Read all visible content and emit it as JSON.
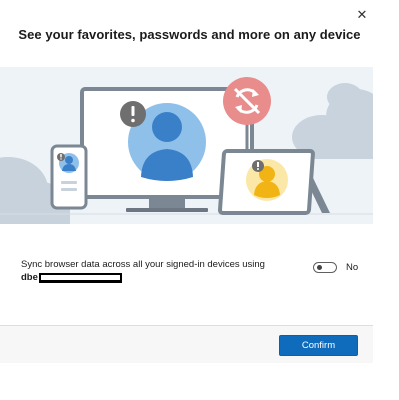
{
  "dialog": {
    "title": "See your favorites, passwords and more on any device",
    "close_icon": "✕"
  },
  "illustration": {
    "devices": [
      "phone",
      "monitor",
      "tablet"
    ],
    "alert_icon": "!",
    "sync_off_icon": "sync-off",
    "colors": {
      "background": "#eef3f8",
      "avatar_blue": "#5b9bd5",
      "avatar_yellow": "#f2c12e",
      "sync_badge": "#e88c8c"
    }
  },
  "sync": {
    "description": "Sync browser data across all your signed-in devices using",
    "account_prefix": "dbe",
    "toggle_state": "off",
    "toggle_label": "No"
  },
  "footer": {
    "confirm_label": "Confirm"
  },
  "colors": {
    "accent": "#0f6cbd"
  }
}
